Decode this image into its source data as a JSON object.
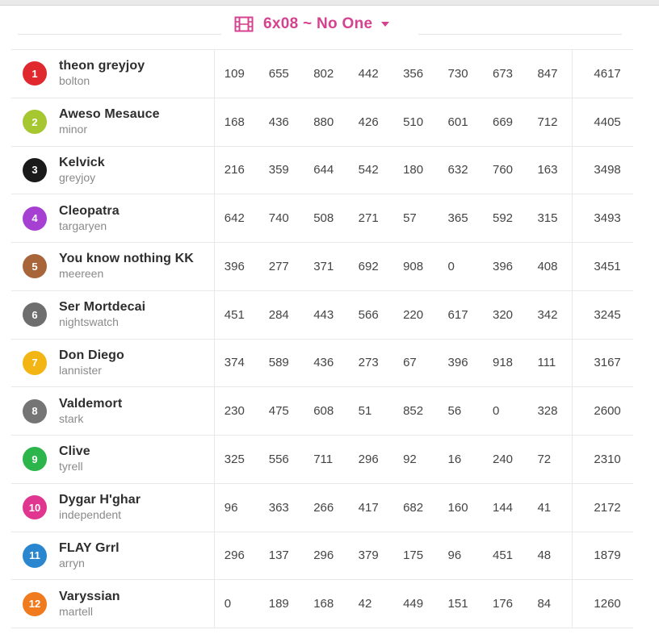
{
  "header": {
    "episode_label": "6x08 ~ No One",
    "accent_color": "#d5428f",
    "icon": "film-icon"
  },
  "rows": [
    {
      "rank": "1",
      "name": "theon greyjoy",
      "house": "bolton",
      "color": "#e0282f",
      "scores": [
        "109",
        "655",
        "802",
        "442",
        "356",
        "730",
        "673",
        "847"
      ],
      "total": "4617"
    },
    {
      "rank": "2",
      "name": "Aweso Mesauce",
      "house": "minor",
      "color": "#a6c72f",
      "scores": [
        "168",
        "436",
        "880",
        "426",
        "510",
        "601",
        "669",
        "712"
      ],
      "total": "4405"
    },
    {
      "rank": "3",
      "name": "Kelvick",
      "house": "greyjoy",
      "color": "#1a1a1a",
      "scores": [
        "216",
        "359",
        "644",
        "542",
        "180",
        "632",
        "760",
        "163"
      ],
      "total": "3498"
    },
    {
      "rank": "4",
      "name": "Cleopatra",
      "house": "targaryen",
      "color": "#a640d3",
      "scores": [
        "642",
        "740",
        "508",
        "271",
        "57",
        "365",
        "592",
        "315"
      ],
      "total": "3493"
    },
    {
      "rank": "5",
      "name": "You know nothing KK",
      "house": "meereen",
      "color": "#a8653a",
      "scores": [
        "396",
        "277",
        "371",
        "692",
        "908",
        "0",
        "396",
        "408"
      ],
      "total": "3451"
    },
    {
      "rank": "6",
      "name": "Ser Mortdecai",
      "house": "nightswatch",
      "color": "#6e6e6e",
      "scores": [
        "451",
        "284",
        "443",
        "566",
        "220",
        "617",
        "320",
        "342"
      ],
      "total": "3245"
    },
    {
      "rank": "7",
      "name": "Don Diego",
      "house": "lannister",
      "color": "#f3b513",
      "scores": [
        "374",
        "589",
        "436",
        "273",
        "67",
        "396",
        "918",
        "111"
      ],
      "total": "3167"
    },
    {
      "rank": "8",
      "name": "Valdemort",
      "house": "stark",
      "color": "#757575",
      "scores": [
        "230",
        "475",
        "608",
        "51",
        "852",
        "56",
        "0",
        "328"
      ],
      "total": "2600"
    },
    {
      "rank": "9",
      "name": "Clive",
      "house": "tyrell",
      "color": "#2bb54a",
      "scores": [
        "325",
        "556",
        "711",
        "296",
        "92",
        "16",
        "240",
        "72"
      ],
      "total": "2310"
    },
    {
      "rank": "10",
      "name": "Dygar H'ghar",
      "house": "independent",
      "color": "#e0368f",
      "scores": [
        "96",
        "363",
        "266",
        "417",
        "682",
        "160",
        "144",
        "41"
      ],
      "total": "2172"
    },
    {
      "rank": "11",
      "name": "FLAY Grrl",
      "house": "arryn",
      "color": "#2a86cf",
      "scores": [
        "296",
        "137",
        "296",
        "379",
        "175",
        "96",
        "451",
        "48"
      ],
      "total": "1879"
    },
    {
      "rank": "12",
      "name": "Varyssian",
      "house": "martell",
      "color": "#f07a1e",
      "scores": [
        "0",
        "189",
        "168",
        "42",
        "449",
        "151",
        "176",
        "84"
      ],
      "total": "1260"
    }
  ]
}
